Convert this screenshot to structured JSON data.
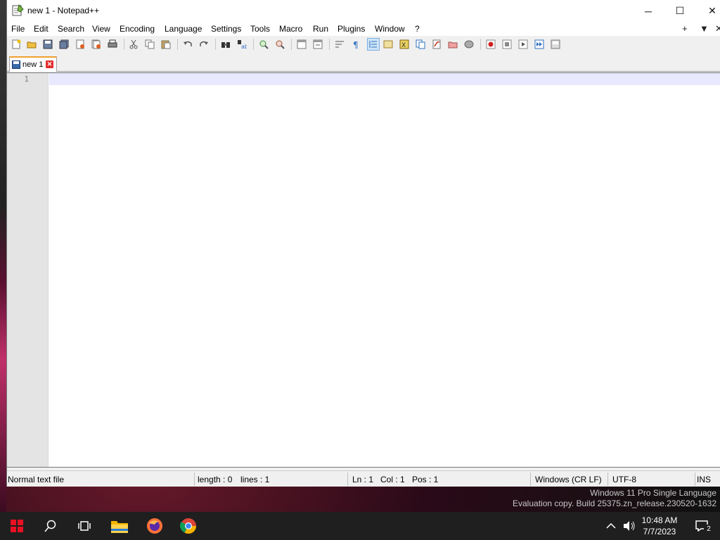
{
  "window": {
    "title": "new 1 - Notepad++",
    "minimize": "─",
    "maximize": "☐",
    "close": "✕"
  },
  "menu": {
    "items": [
      "File",
      "Edit",
      "Search",
      "View",
      "Encoding",
      "Language",
      "Settings",
      "Tools",
      "Macro",
      "Run",
      "Plugins",
      "Window",
      "?"
    ],
    "right": [
      "+",
      "▼",
      "✕"
    ]
  },
  "toolbar": {
    "buttons": [
      "new-file-icon",
      "open-file-icon",
      "save-icon",
      "save-all-icon",
      "close-icon",
      "close-all-icon",
      "print-icon",
      "cut-icon",
      "copy-icon",
      "paste-icon",
      "undo-icon",
      "redo-icon",
      "find-icon",
      "replace-icon",
      "zoom-in-icon",
      "zoom-out-icon",
      "sync-vertical-icon",
      "sync-horizontal-icon",
      "word-wrap-icon",
      "show-all-chars-icon",
      "indent-guide-icon",
      "user-defined-language-icon",
      "document-map-icon",
      "function-list-icon",
      "folder-as-workspace-icon",
      "document-list-icon",
      "monitoring-icon",
      "record-macro-icon",
      "stop-record-icon",
      "play-macro-icon",
      "run-macro-multiple-icon",
      "save-macro-icon"
    ]
  },
  "tab": {
    "label": "new 1",
    "close": "✕"
  },
  "editor": {
    "line_number": "1"
  },
  "status": {
    "file_type": "Normal text file",
    "length": "length : 0",
    "lines": "lines : 1",
    "ln": "Ln : 1",
    "col": "Col : 1",
    "pos": "Pos : 1",
    "eol": "Windows (CR LF)",
    "encoding": "UTF-8",
    "mode": "INS"
  },
  "watermark": {
    "line1": "Windows 11 Pro Single Language",
    "line2": "Evaluation copy. Build 25375.zn_release.230520-1632"
  },
  "taskbar": {
    "time": "10:48 AM",
    "date": "7/7/2023",
    "notifications": "2"
  },
  "colors": {
    "accent_tab": "#f0a030",
    "current_line": "#e8e8ff",
    "taskbar": "#1f1f1f"
  }
}
